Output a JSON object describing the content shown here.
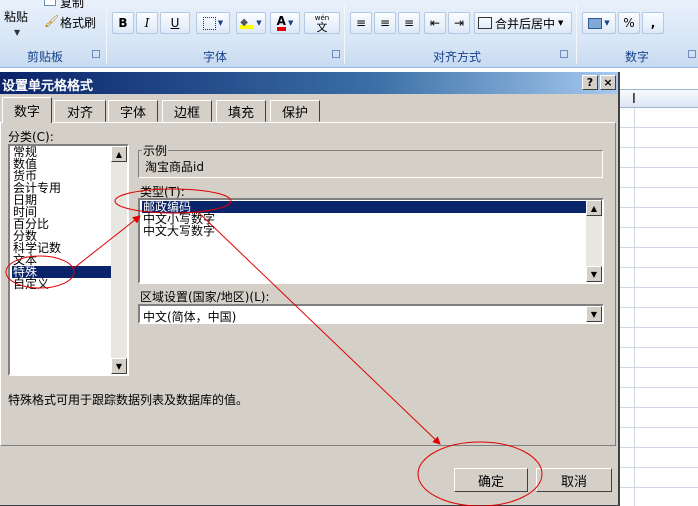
{
  "ribbon": {
    "paste_label": "粘贴",
    "copy_label": "复制",
    "format_painter_label": "格式刷",
    "clipboard_group": "剪贴板",
    "font_group": "字体",
    "alignment_group": "对齐方式",
    "number_group": "数字",
    "merge_center_label": "合并后居中",
    "bold": "B",
    "italic": "I",
    "underline": "U",
    "font_color_glyph": "A",
    "wen_glyph": "wén",
    "wen_char": "文",
    "percent": "%",
    "comma": ","
  },
  "sheet": {
    "cursor_glyph": "I"
  },
  "dialog": {
    "title": "设置单元格格式",
    "help_btn": "?",
    "close_btn": "×",
    "tabs": [
      {
        "label": "数字",
        "active": true
      },
      {
        "label": "对齐",
        "active": false
      },
      {
        "label": "字体",
        "active": false
      },
      {
        "label": "边框",
        "active": false
      },
      {
        "label": "填充",
        "active": false
      },
      {
        "label": "保护",
        "active": false
      }
    ],
    "category_label": "分类(C):",
    "categories": [
      "常规",
      "数值",
      "货币",
      "会计专用",
      "日期",
      "时间",
      "百分比",
      "分数",
      "科学记数",
      "文本",
      "特殊",
      "自定义"
    ],
    "selected_category": "特殊",
    "sample_label": "示例",
    "sample_value": "淘宝商品id",
    "type_label": "类型(T):",
    "types": [
      "邮政编码",
      "中文小写数字",
      "中文大写数字"
    ],
    "selected_type": "邮政编码",
    "locale_label": "区域设置(国家/地区)(L):",
    "locale_value": "中文(简体，中国)",
    "description": "特殊格式可用于跟踪数据列表及数据库的值。",
    "ok_label": "确定",
    "cancel_label": "取消"
  },
  "colors": {
    "title_bar": "#0a246a",
    "dialog_bg": "#d4d0c8",
    "selection": "#0a246a",
    "annotation": "#e00000",
    "ribbon_text": "#15428b"
  }
}
